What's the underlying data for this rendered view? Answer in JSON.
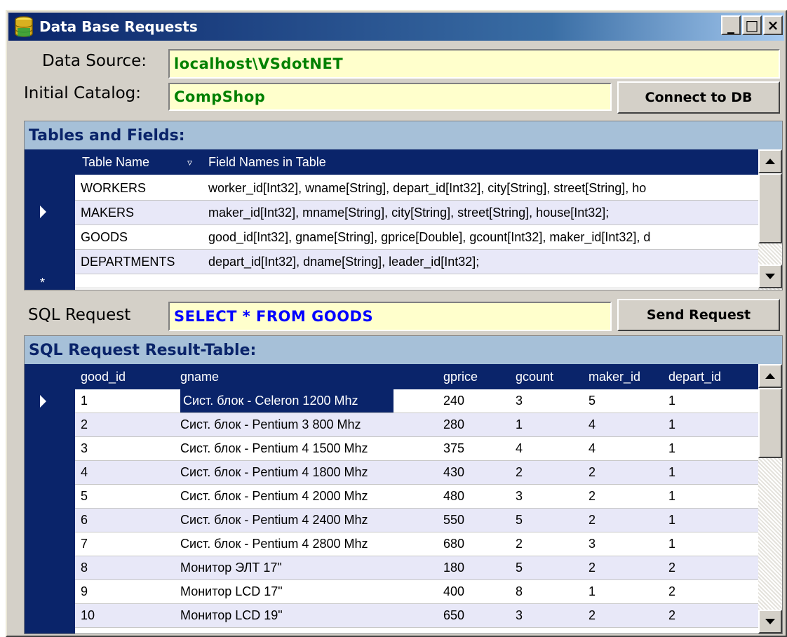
{
  "window": {
    "title": "Data Base Requests",
    "controls": {
      "minimize": "_",
      "maximize": "□",
      "close": "×"
    }
  },
  "connection": {
    "data_source_label": "Data Source:",
    "data_source_value": "localhost\\VSdotNET",
    "catalog_label": "Initial Catalog:",
    "catalog_value": "CompShop",
    "connect_button": "Connect to DB"
  },
  "tables_grid": {
    "caption": "Tables and Fields:",
    "columns": [
      "Table Name",
      "Field Names in Table"
    ],
    "sort_glyph": "▿",
    "new_row_marker": "*",
    "rows": [
      [
        "WORKERS",
        "worker_id[Int32], wname[String], depart_id[Int32], city[String], street[String], ho"
      ],
      [
        "MAKERS",
        "maker_id[Int32], mname[String], city[String], street[String], house[Int32];"
      ],
      [
        "GOODS",
        "good_id[Int32], gname[String], gprice[Double], gcount[Int32], maker_id[Int32], d"
      ],
      [
        "DEPARTMENTS",
        "depart_id[Int32], dname[String], leader_id[Int32];"
      ]
    ]
  },
  "sql": {
    "label": "SQL Request",
    "value": "SELECT * FROM GOODS",
    "send_button": "Send Request"
  },
  "result_grid": {
    "caption": "SQL Request Result-Table:",
    "columns": [
      "good_id",
      "gname",
      "gprice",
      "gcount",
      "maker_id",
      "depart_id"
    ],
    "rows": [
      [
        "1",
        "Сист. блок - Celeron 1200 Mhz",
        "240",
        "3",
        "5",
        "1"
      ],
      [
        "2",
        "Сист. блок - Pentium 3 800 Mhz",
        "280",
        "1",
        "4",
        "1"
      ],
      [
        "3",
        "Сист. блок - Pentium 4 1500 Mhz",
        "375",
        "4",
        "4",
        "1"
      ],
      [
        "4",
        "Сист. блок - Pentium 4 1800 Mhz",
        "430",
        "2",
        "2",
        "1"
      ],
      [
        "5",
        "Сист. блок - Pentium 4 2000 Mhz",
        "480",
        "3",
        "2",
        "1"
      ],
      [
        "6",
        "Сист. блок - Pentium 4 2400 Mhz",
        "550",
        "5",
        "2",
        "1"
      ],
      [
        "7",
        "Сист. блок - Pentium 4 2800 Mhz",
        "680",
        "2",
        "3",
        "1"
      ],
      [
        "8",
        "Монитор ЭЛТ 17\"",
        "180",
        "5",
        "2",
        "2"
      ],
      [
        "9",
        "Монитор LCD 17\"",
        "400",
        "8",
        "1",
        "2"
      ],
      [
        "10",
        "Монитор LCD 19\"",
        "650",
        "3",
        "2",
        "2"
      ]
    ]
  },
  "colors": {
    "titlebar": "#0a246a",
    "window_bg": "#d4d0c8",
    "field_bg": "#ffffcc",
    "field_text_green": "#008000",
    "field_text_blue": "#0000ff",
    "grid_header_bg": "#0a246a",
    "grid_caption_bg": "#a6c0d8"
  }
}
